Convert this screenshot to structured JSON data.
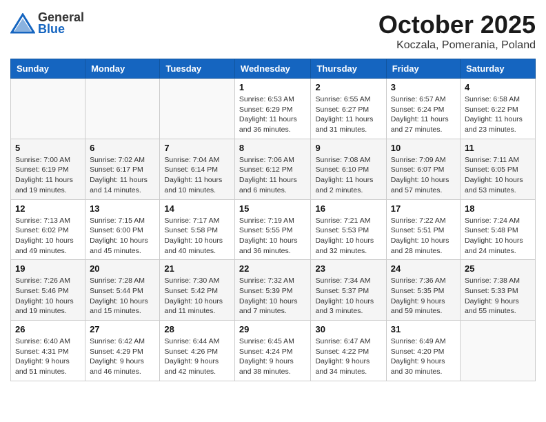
{
  "header": {
    "logo_general": "General",
    "logo_blue": "Blue",
    "month": "October 2025",
    "location": "Koczala, Pomerania, Poland"
  },
  "weekdays": [
    "Sunday",
    "Monday",
    "Tuesday",
    "Wednesday",
    "Thursday",
    "Friday",
    "Saturday"
  ],
  "weeks": [
    [
      {
        "day": "",
        "info": ""
      },
      {
        "day": "",
        "info": ""
      },
      {
        "day": "",
        "info": ""
      },
      {
        "day": "1",
        "info": "Sunrise: 6:53 AM\nSunset: 6:29 PM\nDaylight: 11 hours\nand 36 minutes."
      },
      {
        "day": "2",
        "info": "Sunrise: 6:55 AM\nSunset: 6:27 PM\nDaylight: 11 hours\nand 31 minutes."
      },
      {
        "day": "3",
        "info": "Sunrise: 6:57 AM\nSunset: 6:24 PM\nDaylight: 11 hours\nand 27 minutes."
      },
      {
        "day": "4",
        "info": "Sunrise: 6:58 AM\nSunset: 6:22 PM\nDaylight: 11 hours\nand 23 minutes."
      }
    ],
    [
      {
        "day": "5",
        "info": "Sunrise: 7:00 AM\nSunset: 6:19 PM\nDaylight: 11 hours\nand 19 minutes."
      },
      {
        "day": "6",
        "info": "Sunrise: 7:02 AM\nSunset: 6:17 PM\nDaylight: 11 hours\nand 14 minutes."
      },
      {
        "day": "7",
        "info": "Sunrise: 7:04 AM\nSunset: 6:14 PM\nDaylight: 11 hours\nand 10 minutes."
      },
      {
        "day": "8",
        "info": "Sunrise: 7:06 AM\nSunset: 6:12 PM\nDaylight: 11 hours\nand 6 minutes."
      },
      {
        "day": "9",
        "info": "Sunrise: 7:08 AM\nSunset: 6:10 PM\nDaylight: 11 hours\nand 2 minutes."
      },
      {
        "day": "10",
        "info": "Sunrise: 7:09 AM\nSunset: 6:07 PM\nDaylight: 10 hours\nand 57 minutes."
      },
      {
        "day": "11",
        "info": "Sunrise: 7:11 AM\nSunset: 6:05 PM\nDaylight: 10 hours\nand 53 minutes."
      }
    ],
    [
      {
        "day": "12",
        "info": "Sunrise: 7:13 AM\nSunset: 6:02 PM\nDaylight: 10 hours\nand 49 minutes."
      },
      {
        "day": "13",
        "info": "Sunrise: 7:15 AM\nSunset: 6:00 PM\nDaylight: 10 hours\nand 45 minutes."
      },
      {
        "day": "14",
        "info": "Sunrise: 7:17 AM\nSunset: 5:58 PM\nDaylight: 10 hours\nand 40 minutes."
      },
      {
        "day": "15",
        "info": "Sunrise: 7:19 AM\nSunset: 5:55 PM\nDaylight: 10 hours\nand 36 minutes."
      },
      {
        "day": "16",
        "info": "Sunrise: 7:21 AM\nSunset: 5:53 PM\nDaylight: 10 hours\nand 32 minutes."
      },
      {
        "day": "17",
        "info": "Sunrise: 7:22 AM\nSunset: 5:51 PM\nDaylight: 10 hours\nand 28 minutes."
      },
      {
        "day": "18",
        "info": "Sunrise: 7:24 AM\nSunset: 5:48 PM\nDaylight: 10 hours\nand 24 minutes."
      }
    ],
    [
      {
        "day": "19",
        "info": "Sunrise: 7:26 AM\nSunset: 5:46 PM\nDaylight: 10 hours\nand 19 minutes."
      },
      {
        "day": "20",
        "info": "Sunrise: 7:28 AM\nSunset: 5:44 PM\nDaylight: 10 hours\nand 15 minutes."
      },
      {
        "day": "21",
        "info": "Sunrise: 7:30 AM\nSunset: 5:42 PM\nDaylight: 10 hours\nand 11 minutes."
      },
      {
        "day": "22",
        "info": "Sunrise: 7:32 AM\nSunset: 5:39 PM\nDaylight: 10 hours\nand 7 minutes."
      },
      {
        "day": "23",
        "info": "Sunrise: 7:34 AM\nSunset: 5:37 PM\nDaylight: 10 hours\nand 3 minutes."
      },
      {
        "day": "24",
        "info": "Sunrise: 7:36 AM\nSunset: 5:35 PM\nDaylight: 9 hours\nand 59 minutes."
      },
      {
        "day": "25",
        "info": "Sunrise: 7:38 AM\nSunset: 5:33 PM\nDaylight: 9 hours\nand 55 minutes."
      }
    ],
    [
      {
        "day": "26",
        "info": "Sunrise: 6:40 AM\nSunset: 4:31 PM\nDaylight: 9 hours\nand 51 minutes."
      },
      {
        "day": "27",
        "info": "Sunrise: 6:42 AM\nSunset: 4:29 PM\nDaylight: 9 hours\nand 46 minutes."
      },
      {
        "day": "28",
        "info": "Sunrise: 6:44 AM\nSunset: 4:26 PM\nDaylight: 9 hours\nand 42 minutes."
      },
      {
        "day": "29",
        "info": "Sunrise: 6:45 AM\nSunset: 4:24 PM\nDaylight: 9 hours\nand 38 minutes."
      },
      {
        "day": "30",
        "info": "Sunrise: 6:47 AM\nSunset: 4:22 PM\nDaylight: 9 hours\nand 34 minutes."
      },
      {
        "day": "31",
        "info": "Sunrise: 6:49 AM\nSunset: 4:20 PM\nDaylight: 9 hours\nand 30 minutes."
      },
      {
        "day": "",
        "info": ""
      }
    ]
  ]
}
